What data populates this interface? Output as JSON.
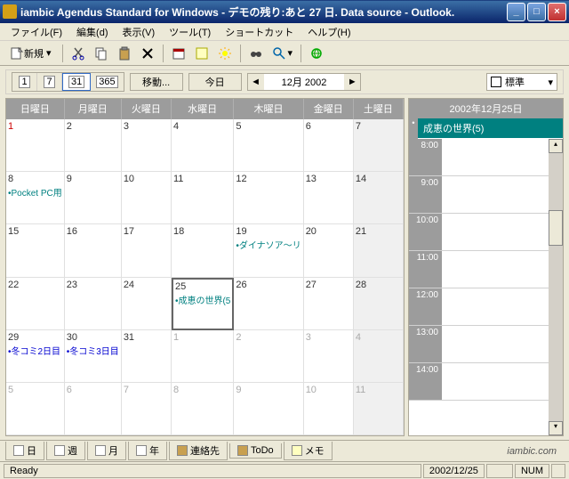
{
  "window": {
    "title": "iambic Agendus Standard for Windows - デモの残り:あと 27 日. Data source - Outlook."
  },
  "menu": {
    "file": "ファイル(F)",
    "edit": "編集(d)",
    "view": "表示(V)",
    "tools": "ツール(T)",
    "shortcut": "ショートカット",
    "help": "ヘルプ(H)"
  },
  "toolbar": {
    "new_label": "新規"
  },
  "nav": {
    "range1": "1",
    "range7": "7",
    "range31": "31",
    "range365": "365",
    "move": "移動...",
    "today": "今日",
    "date": "12月 2002",
    "style": "標準"
  },
  "calendar": {
    "headers": [
      "日曜日",
      "月曜日",
      "火曜日",
      "水曜日",
      "木曜日",
      "金曜日",
      "土曜日"
    ],
    "weeks": [
      [
        {
          "n": "1",
          "red": true
        },
        {
          "n": "2"
        },
        {
          "n": "3"
        },
        {
          "n": "4"
        },
        {
          "n": "5"
        },
        {
          "n": "6"
        },
        {
          "n": "7",
          "we": true
        }
      ],
      [
        {
          "n": "8",
          "evt": "•Pocket PC用"
        },
        {
          "n": "9"
        },
        {
          "n": "10"
        },
        {
          "n": "11"
        },
        {
          "n": "12"
        },
        {
          "n": "13"
        },
        {
          "n": "14",
          "we": true
        }
      ],
      [
        {
          "n": "15"
        },
        {
          "n": "16"
        },
        {
          "n": "17"
        },
        {
          "n": "18"
        },
        {
          "n": "19",
          "evt": "•ダイナソア～リ"
        },
        {
          "n": "20"
        },
        {
          "n": "21",
          "we": true
        }
      ],
      [
        {
          "n": "22"
        },
        {
          "n": "23"
        },
        {
          "n": "24"
        },
        {
          "n": "25",
          "sel": true,
          "evt": "•成恵の世界(5"
        },
        {
          "n": "26"
        },
        {
          "n": "27"
        },
        {
          "n": "28",
          "we": true
        }
      ],
      [
        {
          "n": "29",
          "evt": "•冬コミ2日目",
          "blue": true
        },
        {
          "n": "30",
          "evt": "•冬コミ3日目",
          "blue": true
        },
        {
          "n": "31"
        },
        {
          "n": "1",
          "other": true
        },
        {
          "n": "2",
          "other": true
        },
        {
          "n": "3",
          "other": true
        },
        {
          "n": "4",
          "other": true,
          "we": true
        }
      ],
      [
        {
          "n": "5",
          "other": true
        },
        {
          "n": "6",
          "other": true
        },
        {
          "n": "7",
          "other": true
        },
        {
          "n": "8",
          "other": true
        },
        {
          "n": "9",
          "other": true
        },
        {
          "n": "10",
          "other": true
        },
        {
          "n": "11",
          "other": true,
          "we": true
        }
      ]
    ]
  },
  "day": {
    "header": "2002年12月25日",
    "event": "成恵の世界(5)",
    "times": [
      "8:00",
      "9:00",
      "10:00",
      "11:00",
      "12:00",
      "13:00",
      "14:00"
    ]
  },
  "tabs": {
    "day": "日",
    "week": "週",
    "month": "月",
    "year": "年",
    "contacts": "連絡先",
    "todo": "ToDo",
    "memo": "メモ"
  },
  "brand": "iambic.com",
  "status": {
    "ready": "Ready",
    "date": "2002/12/25",
    "num": "NUM"
  }
}
